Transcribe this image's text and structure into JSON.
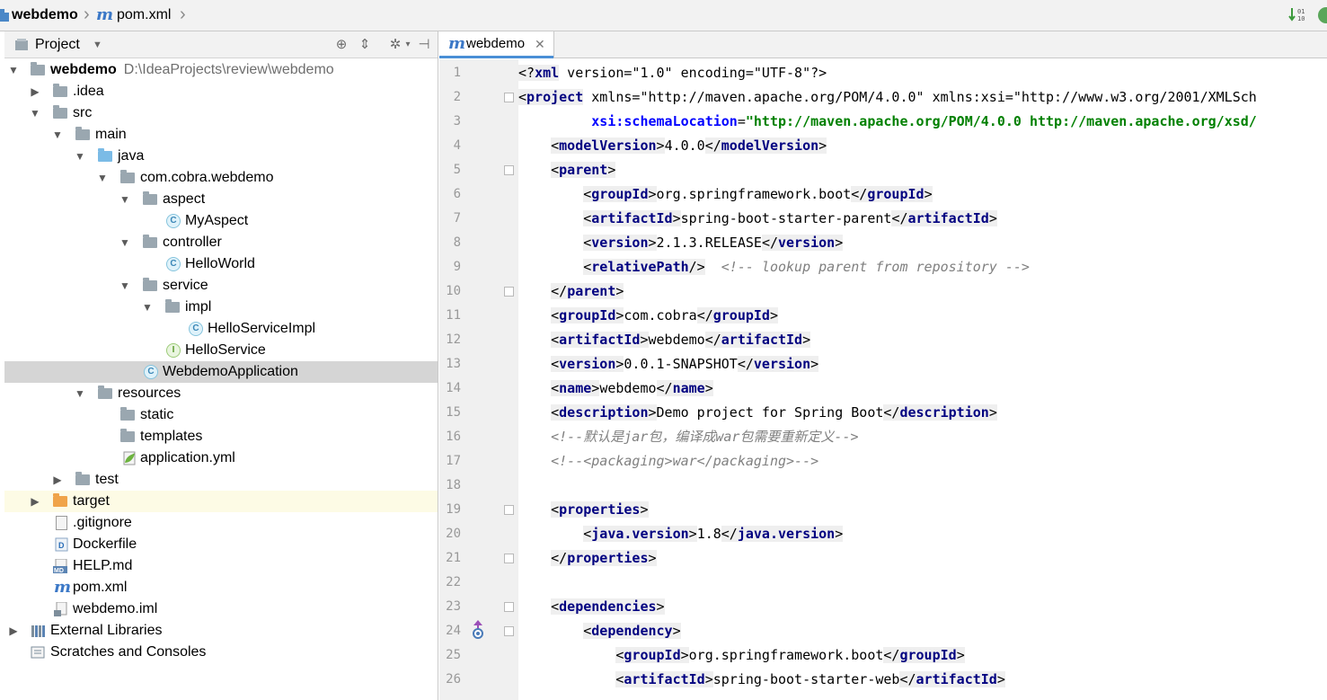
{
  "breadcrumb": {
    "project": "webdemo",
    "file": "pom.xml"
  },
  "project_panel": {
    "title": "Project",
    "tree": [
      {
        "label": "webdemo",
        "path": "D:\\IdeaProjects\\review\\webdemo",
        "icon": "module-folder-icon",
        "bold": true,
        "expanded": true
      },
      {
        "label": ".idea",
        "icon": "folder-icon",
        "expanded": false
      },
      {
        "label": "src",
        "icon": "folder-icon",
        "expanded": true
      },
      {
        "label": "main",
        "icon": "folder-icon",
        "expanded": true
      },
      {
        "label": "java",
        "icon": "source-folder-icon",
        "expanded": true
      },
      {
        "label": "com.cobra.webdemo",
        "icon": "package-icon",
        "expanded": true
      },
      {
        "label": "aspect",
        "icon": "package-icon",
        "expanded": true
      },
      {
        "label": "MyAspect",
        "icon": "class-icon"
      },
      {
        "label": "controller",
        "icon": "package-icon",
        "expanded": true
      },
      {
        "label": "HelloWorld",
        "icon": "class-icon"
      },
      {
        "label": "service",
        "icon": "package-icon",
        "expanded": true
      },
      {
        "label": "impl",
        "icon": "package-icon",
        "expanded": true
      },
      {
        "label": "HelloServiceImpl",
        "icon": "class-icon"
      },
      {
        "label": "HelloService",
        "icon": "interface-icon"
      },
      {
        "label": "WebdemoApplication",
        "icon": "spring-boot-class-icon",
        "selected": true
      },
      {
        "label": "resources",
        "icon": "resources-folder-icon",
        "expanded": true
      },
      {
        "label": "static",
        "icon": "folder-icon"
      },
      {
        "label": "templates",
        "icon": "folder-icon"
      },
      {
        "label": "application.yml",
        "icon": "spring-config-icon"
      },
      {
        "label": "test",
        "icon": "folder-icon",
        "expanded": false
      },
      {
        "label": "target",
        "icon": "excluded-folder-icon",
        "expanded": false
      },
      {
        "label": ".gitignore",
        "icon": "text-file-icon"
      },
      {
        "label": "Dockerfile",
        "icon": "docker-file-icon"
      },
      {
        "label": "HELP.md",
        "icon": "markdown-file-icon"
      },
      {
        "label": "pom.xml",
        "icon": "maven-icon"
      },
      {
        "label": "webdemo.iml",
        "icon": "iml-file-icon"
      },
      {
        "label": "External Libraries",
        "icon": "libraries-icon",
        "expanded": false
      },
      {
        "label": "Scratches and Consoles",
        "icon": "scratches-icon"
      }
    ]
  },
  "editor": {
    "tab_label": "webdemo",
    "line_numbers": [
      "1",
      "2",
      "3",
      "4",
      "5",
      "6",
      "7",
      "8",
      "9",
      "10",
      "11",
      "12",
      "13",
      "14",
      "15",
      "16",
      "17",
      "18",
      "19",
      "20",
      "21",
      "22",
      "23",
      "24",
      "25",
      "26"
    ],
    "current_line": 18,
    "lines": [
      "<?xml version=\"1.0\" encoding=\"UTF-8\"?>",
      "<project xmlns=\"http://maven.apache.org/POM/4.0.0\" xmlns:xsi=\"http://www.w3.org/2001/XMLSch",
      "         xsi:schemaLocation=\"http://maven.apache.org/POM/4.0.0 http://maven.apache.org/xsd/",
      "    <modelVersion>4.0.0</modelVersion>",
      "    <parent>",
      "        <groupId>org.springframework.boot</groupId>",
      "        <artifactId>spring-boot-starter-parent</artifactId>",
      "        <version>2.1.3.RELEASE</version>",
      "        <relativePath/> <!-- lookup parent from repository -->",
      "    </parent>",
      "    <groupId>com.cobra</groupId>",
      "    <artifactId>webdemo</artifactId>",
      "    <version>0.0.1-SNAPSHOT</version>",
      "    <name>webdemo</name>",
      "    <description>Demo project for Spring Boot</description>",
      "    <!--默认是jar包，编译成war包需要重新定义-->",
      "    <!--<packaging>war</packaging>-->",
      "",
      "    <properties>",
      "        <java.version>1.8</java.version>",
      "    </properties>",
      "",
      "    <dependencies>",
      "        <dependency>",
      "            <groupId>org.springframework.boot</groupId>",
      "            <artifactId>spring-boot-starter-web</artifactId>"
    ]
  },
  "colors": {
    "tag": "#000080",
    "attr_name": "#0000ff",
    "attr_value": "#008000",
    "comment": "#808080",
    "selection": "#d5d5d5",
    "current_line": "#fdfbe5",
    "tab_accent": "#4a8fd6"
  }
}
